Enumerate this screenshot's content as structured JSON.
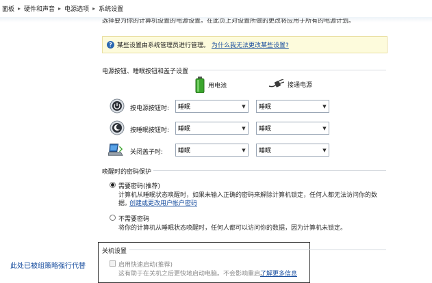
{
  "breadcrumb": {
    "items": [
      "面板",
      "硬件和声音",
      "电源选项",
      "系统设置"
    ],
    "separator": "▸"
  },
  "top_cut_text": "选择要为你的计算机设置的电源设置。在此页上对设置所做的更改将应用于所有的电源计划。",
  "infobox": {
    "text": "某些设置由系统管理员进行管理。",
    "link": "为什么我无法更改某些设置?"
  },
  "buttons_section": {
    "title": "电源按钮、睡眠按钮和盖子设置",
    "col_battery": "用电池",
    "col_plugged": "接通电源",
    "rows": [
      {
        "label": "按电源按钮时:",
        "battery": "睡眠",
        "plugged": "睡眠",
        "icon": "power-button-icon"
      },
      {
        "label": "按睡眠按钮时:",
        "battery": "睡眠",
        "plugged": "睡眠",
        "icon": "sleep-button-icon"
      },
      {
        "label": "关闭盖子时:",
        "battery": "睡眠",
        "plugged": "睡眠",
        "icon": "laptop-lid-icon"
      }
    ]
  },
  "password_section": {
    "title": "唤醒时的密码保护",
    "require": {
      "label": "需要密码(推荐)",
      "desc1": "计算机从睡眠状态唤醒时，如果未输入正确的密码来解除计算机锁定，任何人都无法访问你的数",
      "desc2": "据。",
      "link": "创建或更改用户帐户密码",
      "selected": true
    },
    "no_require": {
      "label": "不需要密码",
      "desc": "将你的计算机从睡眠状态唤醒时，任何人都可以访问你的数据，因为计算机未锁定。",
      "selected": false
    }
  },
  "shutdown_section": {
    "title": "关机设置",
    "fast_startup_label": "启用快速启动(推荐)",
    "fast_startup_desc": "这有助于在关机之后更快地启动电脑。不会影响重启。",
    "fast_startup_link": "了解更多信息"
  },
  "policy_note": "此处已被组策略强行代替"
}
